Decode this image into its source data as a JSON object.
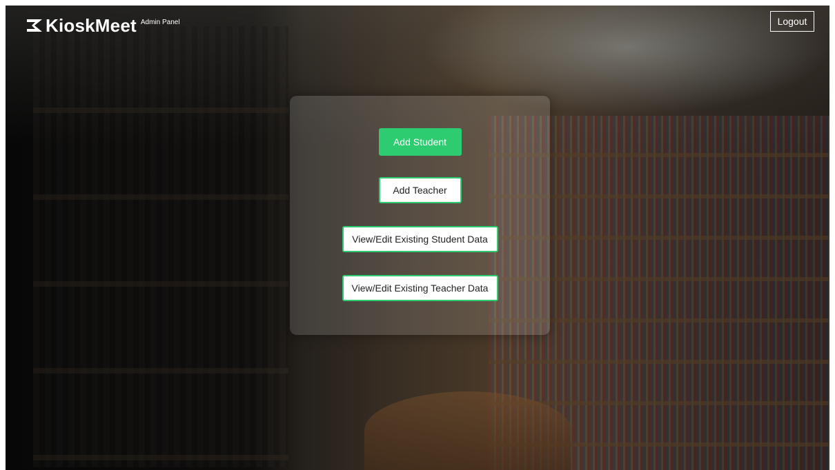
{
  "header": {
    "brand_name": "KioskMeet",
    "brand_subtitle": "Admin Panel",
    "logout_label": "Logout"
  },
  "panel": {
    "buttons": [
      {
        "label": "Add Student"
      },
      {
        "label": "Add Teacher"
      },
      {
        "label": "View/Edit Existing Student Data"
      },
      {
        "label": "View/Edit Existing Teacher Data"
      }
    ]
  },
  "colors": {
    "accent": "#2ecc71",
    "text_light": "#ffffff",
    "button_bg": "#ffffff"
  },
  "icons": {
    "brand": "kioskmeet-logo-icon"
  }
}
